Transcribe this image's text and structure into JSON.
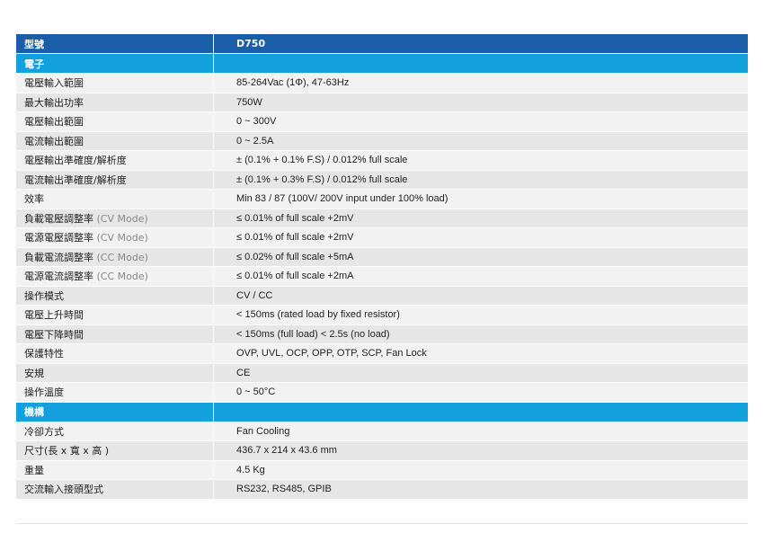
{
  "header": {
    "label": "型號",
    "model": "D750"
  },
  "sections": [
    {
      "title": "電子",
      "rows": [
        {
          "label": "電壓輸入範圍",
          "mode": "",
          "value": "85-264Vac (1Φ), 47-63Hz"
        },
        {
          "label": "最大輸出功率",
          "mode": "",
          "value": "750W"
        },
        {
          "label": "電壓輸出範圍",
          "mode": "",
          "value": "0 ~ 300V"
        },
        {
          "label": "電流輸出範圍",
          "mode": "",
          "value": "0 ~ 2.5A"
        },
        {
          "label": "電壓輸出準確度/解析度",
          "mode": "",
          "value": "± (0.1% + 0.1% F.S) / 0.012% full scale"
        },
        {
          "label": "電流輸出準確度/解析度",
          "mode": "",
          "value": "± (0.1% + 0.3% F.S) / 0.012% full scale"
        },
        {
          "label": "效率",
          "mode": "",
          "value": "Min 83 / 87 (100V/ 200V input under 100% load)"
        },
        {
          "label": "負載電壓調整率",
          "mode": "(CV Mode)",
          "value": "≤ 0.01% of full scale +2mV"
        },
        {
          "label": "電源電壓調整率",
          "mode": "(CV Mode)",
          "value": "≤ 0.01% of full scale +2mV"
        },
        {
          "label": "負載電流調整率",
          "mode": "(CC Mode)",
          "value": "≤ 0.02% of full scale +5mA"
        },
        {
          "label": "電源電流調整率",
          "mode": "(CC Mode)",
          "value": "≤ 0.01% of full scale +2mA"
        },
        {
          "label": "操作模式",
          "mode": "",
          "value": "CV / CC"
        },
        {
          "label": "電壓上升時間",
          "mode": "",
          "value": "< 150ms (rated load by fixed resistor)"
        },
        {
          "label": "電壓下降時間",
          "mode": "",
          "value": "< 150ms (full load) < 2.5s (no load)"
        },
        {
          "label": "保護特性",
          "mode": "",
          "value": "OVP, UVL, OCP, OPP, OTP, SCP, Fan Lock"
        },
        {
          "label": "安規",
          "mode": "",
          "value": "CE"
        },
        {
          "label": "操作溫度",
          "mode": "",
          "value": "0 ~ 50°C"
        }
      ]
    },
    {
      "title": "機構",
      "rows": [
        {
          "label": "冷卻方式",
          "mode": "",
          "value": "Fan Cooling"
        },
        {
          "label": "尺寸(長 x 寬 x 高 )",
          "mode": "",
          "value": "436.7 x 214 x 43.6 mm"
        },
        {
          "label": "重量",
          "mode": "",
          "value": "4.5 Kg"
        },
        {
          "label": "交流輸入接頭型式",
          "mode": "",
          "value": "RS232, RS485, GPIB"
        }
      ]
    }
  ]
}
